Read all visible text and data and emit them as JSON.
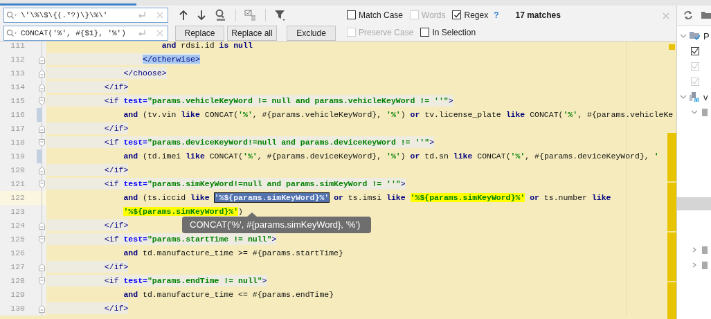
{
  "find": {
    "search": {
      "value": "\\'\\%\\$\\{(.*?)\\}\\%\\'"
    },
    "replace": {
      "value": "CONCAT('%', #{$1}, '%')"
    },
    "options": [
      {
        "label": "Match Case",
        "checked": false,
        "disabled": false
      },
      {
        "label": "Words",
        "checked": false,
        "disabled": true
      },
      {
        "label": "Regex",
        "checked": true,
        "disabled": false
      }
    ],
    "help": "?",
    "matches": "17 matches",
    "buttons": [
      "Replace",
      "Replace all",
      "Exclude"
    ],
    "replace_options": [
      {
        "label": "Preserve Case",
        "checked": false,
        "disabled": true
      },
      {
        "label": "In Selection",
        "checked": false,
        "disabled": false
      }
    ]
  },
  "editor": {
    "lines": [
      {
        "number": "111",
        "fold_start": false,
        "fold_end": false,
        "changed": false,
        "current": false,
        "kind": "sql",
        "segments": [
          {
            "kind": "kw",
            "text": "                        and"
          },
          {
            "kind": "plain",
            "text": " rdsi.id "
          },
          {
            "kind": "kw",
            "text": "is null"
          }
        ]
      },
      {
        "number": "112",
        "fold_start": false,
        "fold_end": true,
        "changed": false,
        "current": false,
        "kind": "xml",
        "segments": [
          {
            "kind": "tag_selected",
            "text": "                    </otherwise>"
          }
        ]
      },
      {
        "number": "113",
        "fold_start": false,
        "fold_end": true,
        "changed": false,
        "current": false,
        "kind": "xml",
        "segments": [
          {
            "kind": "tag",
            "text": "                </choose>"
          }
        ]
      },
      {
        "number": "114",
        "fold_start": false,
        "fold_end": true,
        "changed": false,
        "current": false,
        "kind": "xml",
        "segments": [
          {
            "kind": "tag",
            "text": "            </if>"
          }
        ]
      },
      {
        "number": "115",
        "fold_start": true,
        "fold_end": false,
        "changed": false,
        "current": false,
        "kind": "xml",
        "segments": [
          {
            "kind": "tag",
            "text": "            <if "
          },
          {
            "kind": "attr",
            "text": "test="
          },
          {
            "kind": "value",
            "text": "\"params.vehicleKeyWord != null and params.vehicleKeyWord != ''\""
          },
          {
            "kind": "tag",
            "text": ">"
          }
        ]
      },
      {
        "number": "116",
        "fold_start": false,
        "fold_end": false,
        "changed": true,
        "current": false,
        "kind": "sql",
        "segments": [
          {
            "kind": "kw",
            "text": "                and"
          },
          {
            "kind": "plain",
            "text": " (tv.vin "
          },
          {
            "kind": "kw",
            "text": "like"
          },
          {
            "kind": "plain",
            "text": " CONCAT("
          },
          {
            "kind": "str",
            "text": "'%'"
          },
          {
            "kind": "plain",
            "text": ", #{params.vehicleKeyWord}, "
          },
          {
            "kind": "str",
            "text": "'%'"
          },
          {
            "kind": "plain",
            "text": ") "
          },
          {
            "kind": "kw",
            "text": "or"
          },
          {
            "kind": "plain",
            "text": " tv.license_plate "
          },
          {
            "kind": "kw",
            "text": "like"
          },
          {
            "kind": "plain",
            "text": " CONCAT("
          },
          {
            "kind": "str",
            "text": "'%'"
          },
          {
            "kind": "plain",
            "text": ", #{params.vehicleKe"
          }
        ]
      },
      {
        "number": "117",
        "fold_start": false,
        "fold_end": true,
        "changed": false,
        "current": false,
        "kind": "xml",
        "segments": [
          {
            "kind": "tag",
            "text": "            </if>"
          }
        ]
      },
      {
        "number": "118",
        "fold_start": true,
        "fold_end": false,
        "changed": false,
        "current": false,
        "kind": "xml",
        "segments": [
          {
            "kind": "tag",
            "text": "            <if "
          },
          {
            "kind": "attr",
            "text": "test="
          },
          {
            "kind": "value",
            "text": "\"params.deviceKeyWord!=null and params.deviceKeyWord != ''\""
          },
          {
            "kind": "tag",
            "text": ">"
          }
        ]
      },
      {
        "number": "119",
        "fold_start": false,
        "fold_end": false,
        "changed": true,
        "current": false,
        "kind": "sql",
        "segments": [
          {
            "kind": "kw",
            "text": "                and"
          },
          {
            "kind": "plain",
            "text": " (td.imei "
          },
          {
            "kind": "kw",
            "text": "like"
          },
          {
            "kind": "plain",
            "text": " CONCAT("
          },
          {
            "kind": "str",
            "text": "'%'"
          },
          {
            "kind": "plain",
            "text": ", #{params.deviceKeyWord}, "
          },
          {
            "kind": "str",
            "text": "'%'"
          },
          {
            "kind": "plain",
            "text": ") "
          },
          {
            "kind": "kw",
            "text": "or"
          },
          {
            "kind": "plain",
            "text": " td.sn "
          },
          {
            "kind": "kw",
            "text": "like"
          },
          {
            "kind": "plain",
            "text": " CONCAT("
          },
          {
            "kind": "str",
            "text": "'%'"
          },
          {
            "kind": "plain",
            "text": ", #{params.deviceKeyWord}, "
          },
          {
            "kind": "str",
            "text": "'"
          }
        ]
      },
      {
        "number": "120",
        "fold_start": false,
        "fold_end": true,
        "changed": false,
        "current": false,
        "kind": "xml",
        "segments": [
          {
            "kind": "tag",
            "text": "            </if>"
          }
        ]
      },
      {
        "number": "121",
        "fold_start": true,
        "fold_end": false,
        "changed": false,
        "current": false,
        "kind": "xml",
        "segments": [
          {
            "kind": "tag",
            "text": "            <if "
          },
          {
            "kind": "attr",
            "text": "test="
          },
          {
            "kind": "value",
            "text": "\"params.simKeyWord!=null and params.simKeyWord != ''\""
          },
          {
            "kind": "tag",
            "text": ">"
          }
        ]
      },
      {
        "number": "122",
        "fold_start": false,
        "fold_end": false,
        "changed": false,
        "current": true,
        "kind": "sql",
        "segments": [
          {
            "kind": "kw",
            "text": "                and"
          },
          {
            "kind": "plain",
            "text": " (ts.iccid "
          },
          {
            "kind": "kw",
            "text": "like "
          },
          {
            "kind": "match_current",
            "text": "'%${params.simKeyWord}%'"
          },
          {
            "kind": "kw",
            "text": " or"
          },
          {
            "kind": "plain",
            "text": " ts.imsi "
          },
          {
            "kind": "kw",
            "text": "like "
          },
          {
            "kind": "match",
            "text": "'%${params.simKeyWord}%'"
          },
          {
            "kind": "kw",
            "text": " or"
          },
          {
            "kind": "plain",
            "text": " ts.number "
          },
          {
            "kind": "kw",
            "text": "like"
          }
        ]
      },
      {
        "number": "123",
        "fold_start": false,
        "fold_end": false,
        "changed": false,
        "current": false,
        "kind": "sql",
        "segments": [
          {
            "kind": "match",
            "text": "                '%${params.simKeyWord}%'"
          },
          {
            "kind": "plain",
            "text": ")"
          }
        ]
      },
      {
        "number": "124",
        "fold_start": false,
        "fold_end": true,
        "changed": false,
        "current": false,
        "kind": "xml",
        "segments": [
          {
            "kind": "tag",
            "text": "            </if>"
          }
        ]
      },
      {
        "number": "125",
        "fold_start": true,
        "fold_end": false,
        "changed": false,
        "current": false,
        "kind": "xml",
        "segments": [
          {
            "kind": "tag",
            "text": "            <if "
          },
          {
            "kind": "attr",
            "text": "test="
          },
          {
            "kind": "value",
            "text": "\"params.startTime != null\""
          },
          {
            "kind": "tag",
            "text": ">"
          }
        ]
      },
      {
        "number": "126",
        "fold_start": false,
        "fold_end": false,
        "changed": false,
        "current": false,
        "kind": "sql",
        "segments": [
          {
            "kind": "kw",
            "text": "                and"
          },
          {
            "kind": "plain",
            "text": " td.manufacture_time >= #{params.startTime}"
          }
        ]
      },
      {
        "number": "127",
        "fold_start": false,
        "fold_end": true,
        "changed": false,
        "current": false,
        "kind": "xml",
        "segments": [
          {
            "kind": "tag",
            "text": "            </if>"
          }
        ]
      },
      {
        "number": "128",
        "fold_start": true,
        "fold_end": false,
        "changed": false,
        "current": false,
        "kind": "xml",
        "segments": [
          {
            "kind": "tag",
            "text": "            <if "
          },
          {
            "kind": "attr",
            "text": "test="
          },
          {
            "kind": "value",
            "text": "\"params.endTime != null\""
          },
          {
            "kind": "tag",
            "text": ">"
          }
        ]
      },
      {
        "number": "129",
        "fold_start": false,
        "fold_end": false,
        "changed": false,
        "current": false,
        "kind": "sql",
        "segments": [
          {
            "kind": "kw",
            "text": "                and"
          },
          {
            "kind": "plain",
            "text": " td.manufacture_time <= #{params.endTime}"
          }
        ]
      },
      {
        "number": "130",
        "fold_start": false,
        "fold_end": true,
        "changed": false,
        "current": false,
        "kind": "xml",
        "segments": [
          {
            "kind": "tag",
            "text": "            </if>"
          }
        ]
      }
    ]
  },
  "tooltip": {
    "text": "CONCAT('%', #{params.simKeyWord}, '%')"
  },
  "tree": [
    {
      "kind": "folder",
      "label": "P",
      "expanded": true,
      "children": [
        {
          "kind": "check",
          "disabled": false
        },
        {
          "kind": "check",
          "disabled": true
        },
        {
          "kind": "check",
          "disabled": true
        }
      ]
    },
    {
      "kind": "module",
      "label": "v",
      "expanded": true,
      "children": [
        {
          "kind": "node",
          "expanded": true
        },
        {
          "kind": "blank",
          "selected": true
        },
        {
          "kind": "node",
          "expanded": false
        },
        {
          "kind": "node",
          "expanded": false
        }
      ]
    }
  ]
}
